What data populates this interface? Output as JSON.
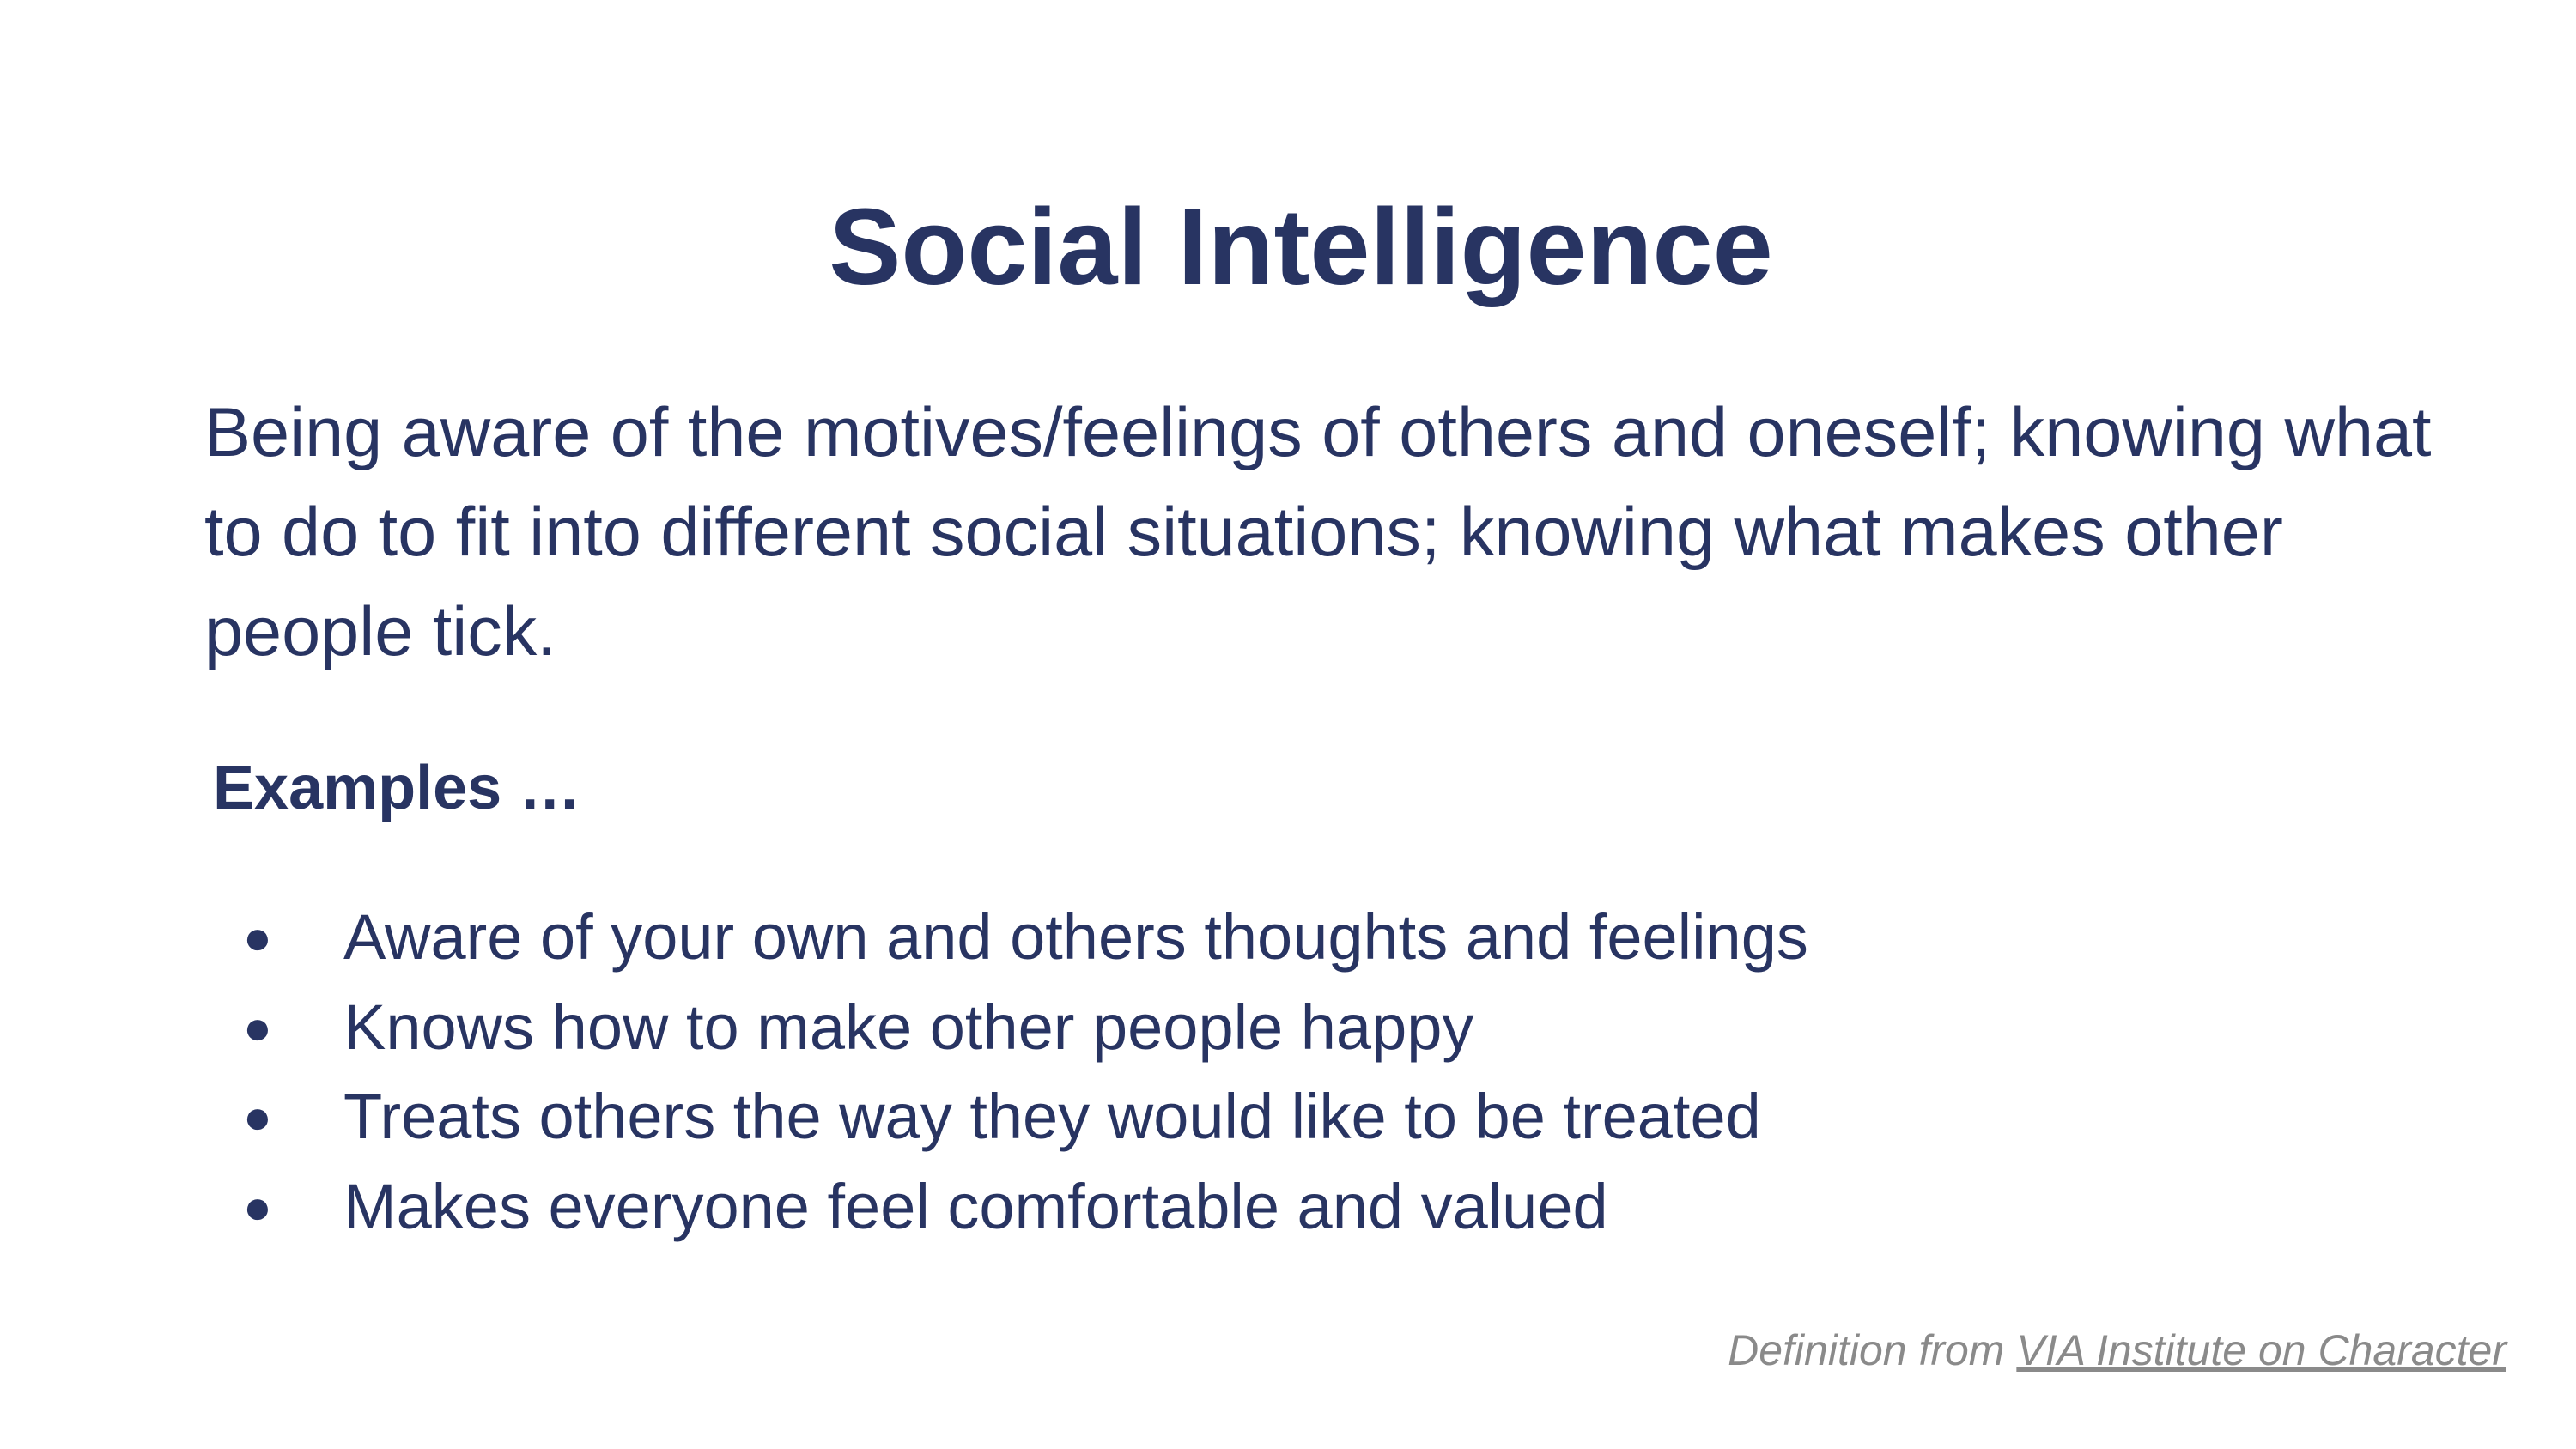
{
  "slide": {
    "title": "Social Intelligence",
    "definition": "Being aware of the motives/feelings of others and oneself; knowing what to do to fit into different social situations; knowing what makes other people tick.",
    "examples_heading": "Examples …",
    "bullet_glyph": "●",
    "examples": [
      "Aware of your own and others thoughts and feelings",
      "Knows how to make other people happy",
      "Treats others the way they would like to be treated",
      "Makes everyone feel comfortable and valued"
    ],
    "credit": {
      "prefix": "Definition from ",
      "link_text": "VIA Institute on Character"
    }
  },
  "colors": {
    "text": "#283462",
    "credit": "#8a8a8a",
    "background": "#ffffff"
  }
}
